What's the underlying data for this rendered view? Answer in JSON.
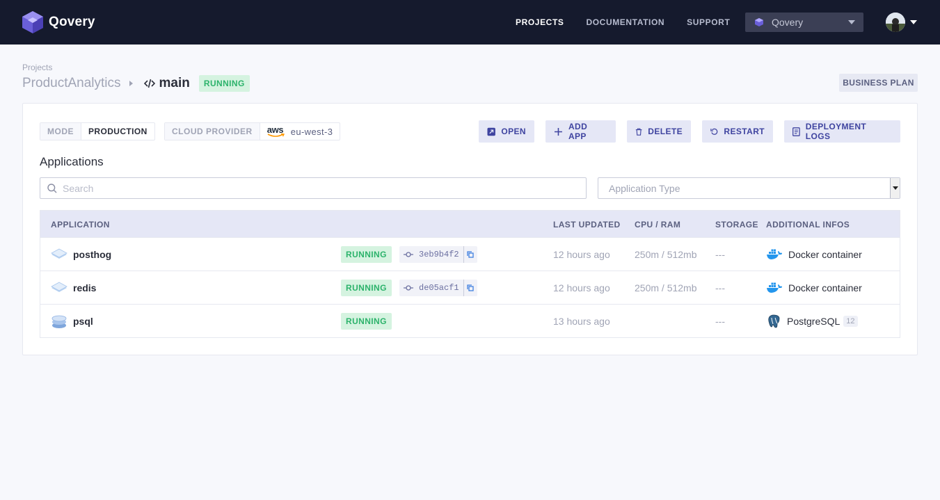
{
  "nav": {
    "brand": "Qovery",
    "links": [
      "PROJECTS",
      "DOCUMENTATION",
      "SUPPORT"
    ],
    "active_link": "PROJECTS",
    "org_select": "Qovery"
  },
  "header": {
    "breadcrumb_label": "Projects",
    "project_name": "ProductAnalytics",
    "environment_name": "main",
    "environment_status": "RUNNING",
    "plan": "BUSINESS PLAN"
  },
  "env_info": {
    "mode_label": "MODE",
    "mode_value": "PRODUCTION",
    "cloud_label": "CLOUD PROVIDER",
    "cloud_logo_text": "aws",
    "region": "eu-west-3"
  },
  "actions": {
    "open": "OPEN",
    "add_app": "ADD APP",
    "delete": "DELETE",
    "restart": "RESTART",
    "logs": "DEPLOYMENT LOGS"
  },
  "applications": {
    "title": "Applications",
    "search_placeholder": "Search",
    "type_placeholder": "Application Type",
    "columns": {
      "application": "APPLICATION",
      "last_updated": "LAST UPDATED",
      "cpu_ram": "CPU / RAM",
      "storage": "STORAGE",
      "additional": "ADDITIONAL INFOS"
    },
    "rows": [
      {
        "name": "posthog",
        "status": "RUNNING",
        "commit": "3eb9b4f2",
        "last_updated": "12 hours ago",
        "cpu_ram": "250m / 512mb",
        "storage": "---",
        "info": "Docker container",
        "info_icon": "docker-icon"
      },
      {
        "name": "redis",
        "status": "RUNNING",
        "commit": "de05acf1",
        "last_updated": "12 hours ago",
        "cpu_ram": "250m / 512mb",
        "storage": "---",
        "info": "Docker container",
        "info_icon": "docker-icon"
      },
      {
        "name": "psql",
        "status": "RUNNING",
        "commit": "",
        "last_updated": "13 hours ago",
        "cpu_ram": "",
        "storage": "---",
        "info": "PostgreSQL",
        "info_version": "12",
        "info_icon": "postgresql-icon"
      }
    ]
  },
  "colors": {
    "navbar": "#151a2d",
    "accent": "#3f44a0",
    "running_bg": "#d5f3e0",
    "running_text": "#2cb36b"
  }
}
